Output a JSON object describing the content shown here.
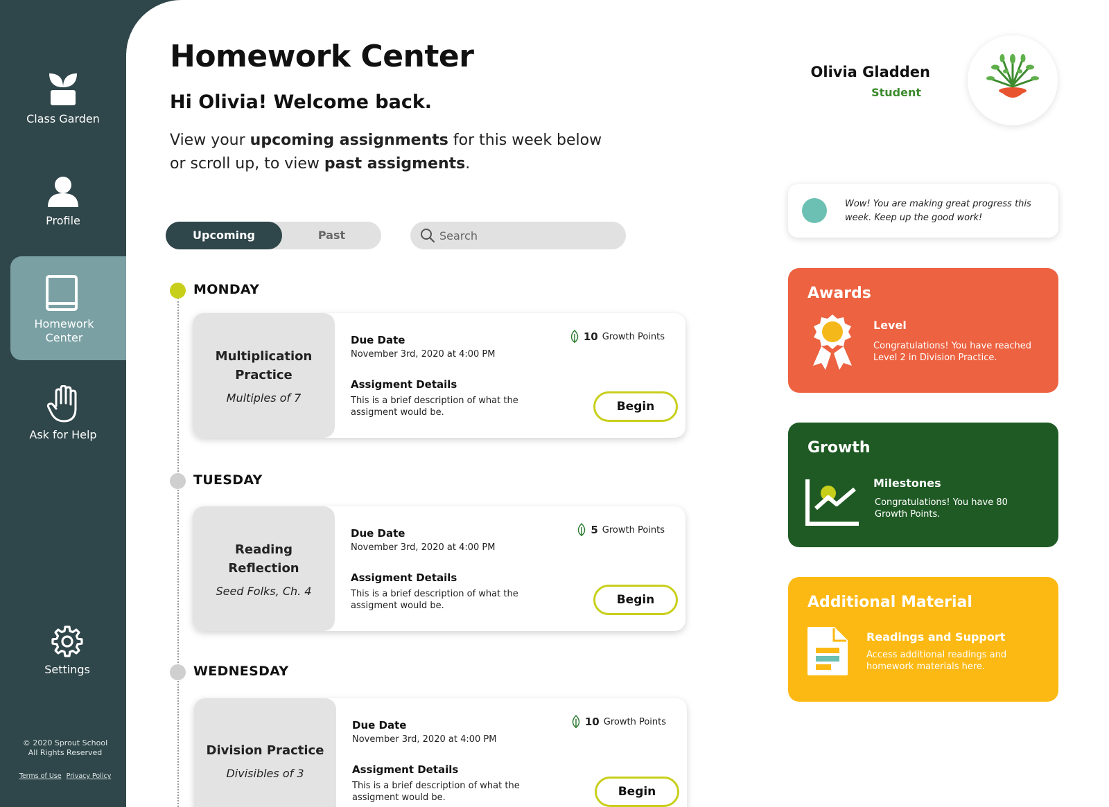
{
  "sidebar": {
    "items": [
      {
        "label": "Class Garden",
        "icon": "sprout-icon"
      },
      {
        "label": "Profile",
        "icon": "user-icon"
      },
      {
        "label": "Homework\nCenter",
        "icon": "book-icon",
        "active": true
      },
      {
        "label": "Ask for Help",
        "icon": "raised-hand-icon"
      },
      {
        "label": "Settings",
        "icon": "gear-icon"
      }
    ],
    "copyright_line1": "© 2020 Sprout School",
    "copyright_line2": "All Rights Reserved",
    "terms": "Terms of Use",
    "privacy": "Privacy Policy"
  },
  "header": {
    "title": "Homework Center",
    "greeting": "Hi Olivia! Welcome back.",
    "intro": {
      "p1": "View your ",
      "b1": "upcoming assignments",
      "p2": " for this week below or scroll up, to view ",
      "b2": "past assigments",
      "p3": "."
    }
  },
  "tabs": [
    {
      "label": "Upcoming",
      "active": true
    },
    {
      "label": "Past",
      "active": false
    }
  ],
  "search": {
    "placeholder": "Search",
    "value": ""
  },
  "days": [
    {
      "label": "MONDAY",
      "dot_color": "#c8cf1a",
      "assignment": {
        "title": "Multiplication Practice",
        "subtitle": "Multiples of 7",
        "due_label": "Due Date",
        "due_value": "November 3rd, 2020 at 4:00 PM",
        "details_label": "Assigment Details",
        "details_value": "This is a brief description of what the assigment would be.",
        "points": "10",
        "points_label": "Growth Points",
        "action": "Begin"
      }
    },
    {
      "label": "TUESDAY",
      "dot_color": "#cfcfcf",
      "assignment": {
        "title": "Reading Reflection",
        "subtitle": "Seed Folks, Ch. 4",
        "due_label": "Due Date",
        "due_value": "November 3rd, 2020 at 4:00 PM",
        "details_label": "Assigment Details",
        "details_value": "This is a brief description of what the assigment would be.",
        "points": "5",
        "points_label": "Growth Points",
        "action": "Begin"
      }
    },
    {
      "label": "WEDNESDAY",
      "dot_color": "#cfcfcf",
      "assignment": {
        "title": "Division Practice",
        "subtitle": "Divisibles of 3",
        "due_label": "Due Date",
        "due_value": "November 3rd, 2020 at 4:00 PM",
        "details_label": "Assigment Details",
        "details_value": "This is a brief description of what the assigment would be.",
        "points": "10",
        "points_label": "Growth Points",
        "action": "Begin"
      }
    }
  ],
  "user": {
    "name": "Olivia Gladden",
    "role": "Student",
    "avatar_icon": "potted-plant-icon"
  },
  "message": {
    "text": "Wow! You are making great progress this week. Keep up the good work!"
  },
  "panels": {
    "awards": {
      "title": "Awards",
      "heading": "Level",
      "text": "Congratulations! You have reached Level 2 in Division Practice.",
      "icon": "award-ribbon-icon",
      "color": "#ed6240"
    },
    "growth": {
      "title": "Growth",
      "heading": "Milestones",
      "text": "Congratulations! You have 80 Growth Points.",
      "icon": "growth-chart-icon",
      "color": "#1f5a24"
    },
    "additional": {
      "title": "Additional Material",
      "heading": "Readings and Support",
      "text": "Access additional readings and homework materials here.",
      "icon": "document-icon",
      "color": "#fdb913"
    }
  },
  "colors": {
    "sidebar": "#2f464a",
    "active_nav": "#7aa0a3",
    "accent": "#c8cf1a",
    "student_green": "#3c8a2c",
    "message_dot": "#6bc0b3"
  }
}
